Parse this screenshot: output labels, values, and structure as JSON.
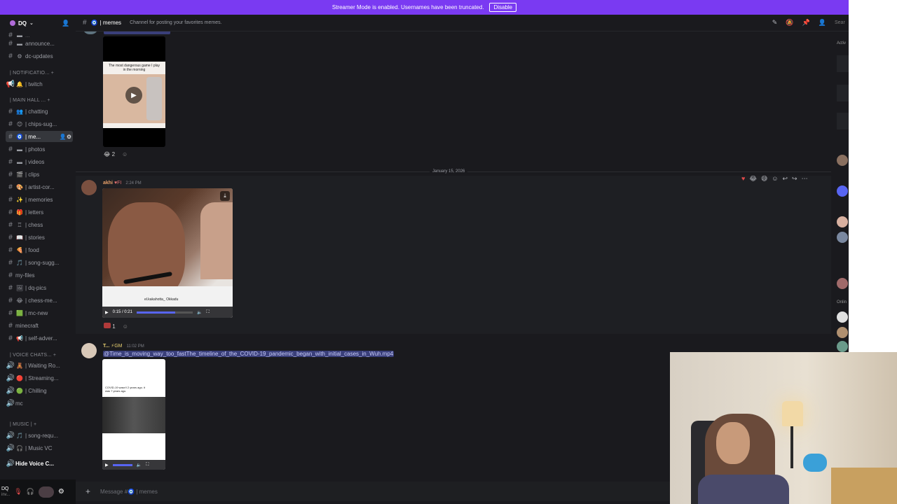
{
  "banner": {
    "text": "Streamer Mode is enabled. Usernames have been truncated.",
    "button": "Disable"
  },
  "server": {
    "name": "DQ"
  },
  "sidebar": {
    "channels": [
      {
        "label": "announce...",
        "emoji": "▬"
      },
      {
        "label": "dc-updates",
        "emoji": "⚙"
      },
      {
        "label": "| twitch",
        "emoji": "🔔",
        "voice": true
      }
    ],
    "cat_notifications": "| NOTIFICATIO...",
    "cat_mainhall": "| MAIN HALL ...",
    "main": [
      {
        "label": "| chatting",
        "emoji": "👥"
      },
      {
        "label": "| chips-sug...",
        "emoji": "😊"
      },
      {
        "label": "| me...",
        "emoji": "🧿",
        "active": true
      },
      {
        "label": "| photos",
        "emoji": "▬"
      },
      {
        "label": "| videos",
        "emoji": "▬"
      },
      {
        "label": "| clips",
        "emoji": "🎬"
      },
      {
        "label": "| artist-cor...",
        "emoji": "🎨"
      },
      {
        "label": "| memories",
        "emoji": "✨"
      },
      {
        "label": "| letters",
        "emoji": "🎁"
      },
      {
        "label": "| chess",
        "emoji": "♖"
      },
      {
        "label": "| stories",
        "emoji": "📖"
      },
      {
        "label": "| food",
        "emoji": "🍕"
      },
      {
        "label": "| song-sugg...",
        "emoji": "🎵"
      },
      {
        "label": "my-files",
        "emoji": ""
      },
      {
        "label": "| dq-pics",
        "emoji": "🖼"
      },
      {
        "label": "| chess-me...",
        "emoji": "😂"
      },
      {
        "label": "| mc-new",
        "emoji": "🟩"
      },
      {
        "label": "minecraft",
        "emoji": ""
      },
      {
        "label": "| self-adver...",
        "emoji": "📢"
      }
    ],
    "cat_voice": "| VOICE CHATS...",
    "voice": [
      {
        "label": "| Waiting Ro...",
        "emoji": "🧸"
      },
      {
        "label": "| Streaming...",
        "emoji": "🔴"
      },
      {
        "label": "| Chilling",
        "emoji": "🟢"
      },
      {
        "label": "mc",
        "emoji": ""
      }
    ],
    "cat_music": "| MUSIC |",
    "music": [
      {
        "label": "| song-requ...",
        "emoji": "🎵"
      },
      {
        "label": "| Music VC",
        "emoji": "🎧"
      }
    ],
    "hide_voice": "Hide Voice C..."
  },
  "userbar": {
    "name": "DQ",
    "status": "inv..."
  },
  "channel": {
    "name": "| memes",
    "topic": "Channel for posting your favorites memes."
  },
  "messages": {
    "top_reaction_count": "2",
    "date_divider": "January 15, 2026",
    "video_caption": "The most dangerous game I play in the morning",
    "msg1": {
      "author": "akhi",
      "tag": "FI",
      "time": "2:24 PM",
      "video_time": "0:15 / 0:21",
      "watermark": "el.kakahotta_ Okkadu",
      "reaction_count": "1"
    },
    "msg2": {
      "author": "T...",
      "tag": "GM",
      "time": "11:02 PM",
      "filename": "@Time_is_moving_way_too_fastThe_timeline_of_the_COVID-19_pandemic_began_with_initial_cases_in_Wuh.mp4",
      "thumb_text": "COVID-19 wasn't 2 years ago. it was 7 years ago."
    }
  },
  "composer": {
    "placeholder": "Message #🧿 | memes"
  },
  "memberlist": {
    "title": "Activ",
    "online": "Onlin"
  },
  "colors": {
    "accent": "#7a3af2",
    "bg": "#1a1a1e",
    "link": "#8ea1f7"
  }
}
